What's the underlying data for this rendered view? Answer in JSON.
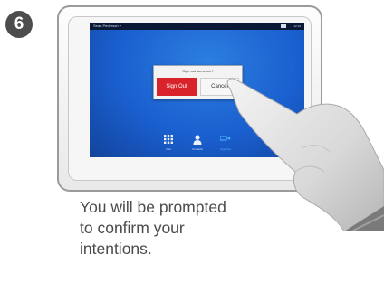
{
  "step": {
    "number": "6"
  },
  "screen": {
    "topbar": {
      "user": "Sean Pederson ▾",
      "clock": "12:16"
    },
    "dialog": {
      "question": "Sign out someone?",
      "signout_label": "Sign Out",
      "cancel_label": "Cancel"
    },
    "dock": [
      {
        "label": "Dial"
      },
      {
        "label": "Contacts"
      },
      {
        "label": "Sign Out"
      }
    ]
  },
  "caption": {
    "line1": "You will be prompted",
    "line2": "to confirm your",
    "line3": "intentions."
  },
  "colors": {
    "screen_blue": "#1a5fcf",
    "signout_red": "#d8232a",
    "active_blue": "#4fb7ff"
  }
}
